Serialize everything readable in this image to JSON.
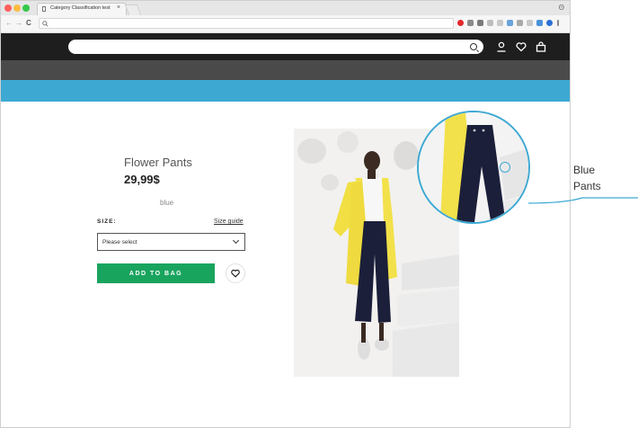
{
  "browser": {
    "tab_title": "Category Classification test",
    "tab_close": "×",
    "address": "",
    "profile_glyph": "Θ",
    "nav_back": "←",
    "nav_forward": "→",
    "nav_reload": "C",
    "omnibox_icon": "search-icon",
    "window_controls": {
      "close": "#fc605b",
      "minimize": "#fdbc40",
      "maximize": "#34c84a"
    },
    "extension_colors": [
      "#e2292b",
      "#8a8a8a",
      "#7a7a7a",
      "#bdbdbd",
      "#c9c9c9",
      "#6aa2dc",
      "#a9a9a9",
      "#c8c8c8",
      "#4a90d9",
      "#2a6fd6",
      "#888888"
    ]
  },
  "site": {
    "search_placeholder": "",
    "header_icons": [
      "search-icon",
      "user-icon",
      "heart-icon",
      "bag-icon"
    ],
    "colors": {
      "header": "#1e1e1e",
      "category_bar": "#4a4a4a",
      "banner": "#3da9d3",
      "add_button": "#19a45e"
    }
  },
  "product": {
    "name": "Flower Pants",
    "price": "29,99$",
    "color": "blue",
    "size_label": "SIZE:",
    "size_guide": "Size guide",
    "size_select": "Please select",
    "add_to_bag": "ADD TO BAG"
  },
  "annotation": {
    "line1": "Blue",
    "line2": "Pants"
  }
}
